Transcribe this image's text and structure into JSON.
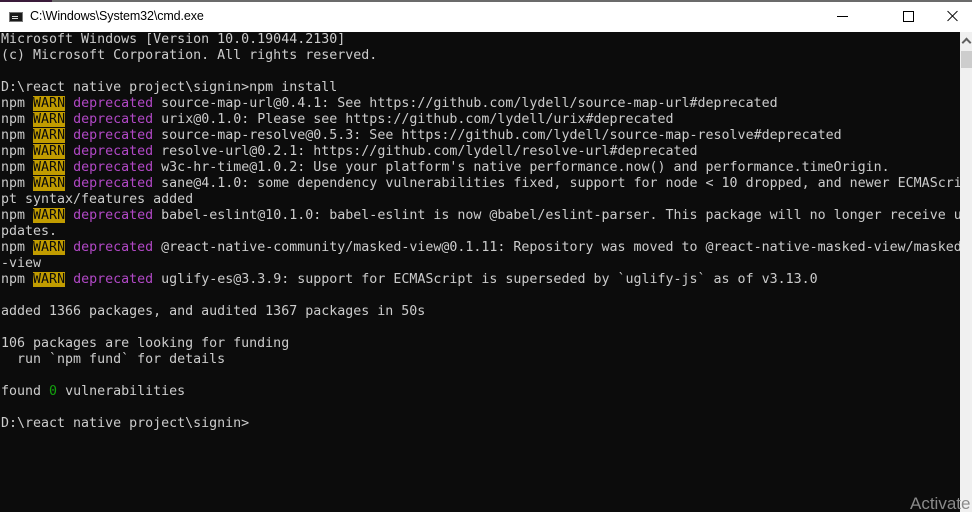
{
  "window": {
    "title": "C:\\Windows\\System32\\cmd.exe",
    "controls": {
      "minimize": "minimize",
      "maximize": "maximize",
      "close": "close"
    }
  },
  "colors": {
    "console_bg": "#0c0c0c",
    "text": "#cccccc",
    "warn_bg": "#c19c00",
    "deprecated": "#b148c6",
    "success": "#13a10e"
  },
  "console": {
    "lines": [
      {
        "type": "text",
        "text": "Microsoft Windows [Version 10.0.19044.2130]"
      },
      {
        "type": "text",
        "text": "(c) Microsoft Corporation. All rights reserved."
      },
      {
        "type": "text",
        "text": ""
      },
      {
        "type": "text",
        "text": "D:\\react native project\\signin>npm install"
      },
      {
        "type": "warn",
        "prefix": "npm",
        "level": "WARN",
        "tag": "deprecated",
        "text": "source-map-url@0.4.1: See https://github.com/lydell/source-map-url#deprecated"
      },
      {
        "type": "warn",
        "prefix": "npm",
        "level": "WARN",
        "tag": "deprecated",
        "text": "urix@0.1.0: Please see https://github.com/lydell/urix#deprecated"
      },
      {
        "type": "warn",
        "prefix": "npm",
        "level": "WARN",
        "tag": "deprecated",
        "text": "source-map-resolve@0.5.3: See https://github.com/lydell/source-map-resolve#deprecated"
      },
      {
        "type": "warn",
        "prefix": "npm",
        "level": "WARN",
        "tag": "deprecated",
        "text": "resolve-url@0.2.1: https://github.com/lydell/resolve-url#deprecated"
      },
      {
        "type": "warn",
        "prefix": "npm",
        "level": "WARN",
        "tag": "deprecated",
        "text": "w3c-hr-time@1.0.2: Use your platform's native performance.now() and performance.timeOrigin."
      },
      {
        "type": "warn",
        "prefix": "npm",
        "level": "WARN",
        "tag": "deprecated",
        "text": "sane@4.1.0: some dependency vulnerabilities fixed, support for node < 10 dropped, and newer ECMAScri"
      },
      {
        "type": "text",
        "text": "pt syntax/features added"
      },
      {
        "type": "warn",
        "prefix": "npm",
        "level": "WARN",
        "tag": "deprecated",
        "text": "babel-eslint@10.1.0: babel-eslint is now @babel/eslint-parser. This package will no longer receive u"
      },
      {
        "type": "text",
        "text": "pdates."
      },
      {
        "type": "warn",
        "prefix": "npm",
        "level": "WARN",
        "tag": "deprecated",
        "text": "@react-native-community/masked-view@0.1.11: Repository was moved to @react-native-masked-view/masked"
      },
      {
        "type": "text",
        "text": "-view"
      },
      {
        "type": "warn",
        "prefix": "npm",
        "level": "WARN",
        "tag": "deprecated",
        "text": "uglify-es@3.3.9: support for ECMAScript is superseded by `uglify-js` as of v3.13.0"
      },
      {
        "type": "text",
        "text": ""
      },
      {
        "type": "text",
        "text": "added 1366 packages, and audited 1367 packages in 50s"
      },
      {
        "type": "text",
        "text": ""
      },
      {
        "type": "text",
        "text": "106 packages are looking for funding"
      },
      {
        "type": "text",
        "text": "  run `npm fund` for details"
      },
      {
        "type": "text",
        "text": ""
      },
      {
        "type": "vuln",
        "before": "found ",
        "count": "0",
        "after": " vulnerabilities"
      },
      {
        "type": "text",
        "text": ""
      },
      {
        "type": "text",
        "text": "D:\\react native project\\signin>"
      }
    ]
  },
  "watermark": "Activate"
}
